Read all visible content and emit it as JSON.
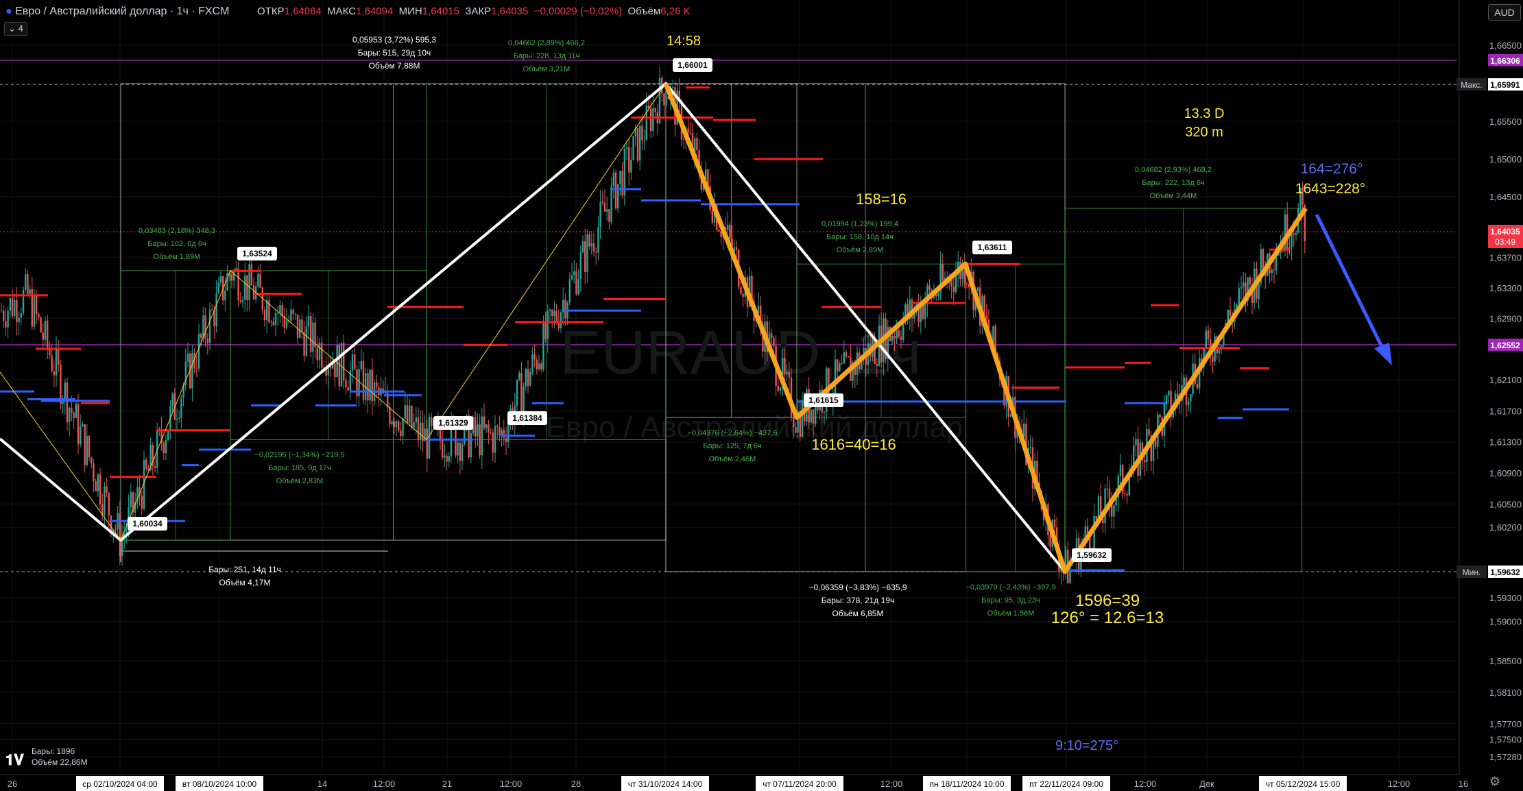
{
  "header": {
    "title": "Евро / Австралийский доллар · 1ч · FXCM",
    "open_label": "ОТКР",
    "open": "1,64064",
    "high_label": "МАКС",
    "high": "1,64094",
    "low_label": "МИН",
    "low": "1,64015",
    "close_label": "ЗАКР",
    "close": "1,64035",
    "change": "−0,00029 (−0,02%)",
    "volume_label": "Объём",
    "volume": "6,26 K",
    "indicator_count": "4",
    "currency": "AUD"
  },
  "watermark": {
    "symbol": "EURAUD, 1ч",
    "name": "Евро / Австралийский доллар"
  },
  "colors": {
    "up": "#26a69a",
    "down": "#ef5350",
    "red_level": "#ff1a1a",
    "blue_level": "#2962ff",
    "orange": "#f7a41d",
    "yellow_text": "#ffeb3b",
    "blue_text": "#5b6cf0",
    "purple_line": "#9c27b0",
    "green_text": "#4caf50"
  },
  "chart_data": {
    "type": "candlestick",
    "symbol": "EURAUD",
    "timeframe": "1ч",
    "ylim": [
      1.57,
      1.67
    ],
    "y_ticks": [
      "1,66500",
      "1,65500",
      "1,65000",
      "1,64500",
      "1,63700",
      "1,63300",
      "1,62900",
      "1,62100",
      "1,61700",
      "1,61300",
      "1,60900",
      "1,60500",
      "1,60200",
      "1,59300",
      "1,59000",
      "1,58500",
      "1,58100",
      "1,57700",
      "1,57500",
      "1,57280"
    ],
    "y_tick_values": [
      1.665,
      1.655,
      1.65,
      1.645,
      1.637,
      1.633,
      1.629,
      1.621,
      1.617,
      1.613,
      1.609,
      1.605,
      1.602,
      1.593,
      1.59,
      1.585,
      1.581,
      1.577,
      1.575,
      1.5728
    ],
    "price_tags": [
      {
        "text": "1,66306",
        "value": 1.66306,
        "color": "#9c27b0"
      },
      {
        "text": "Макс.",
        "value": 1.65991,
        "color": "#333",
        "secondary": "1,65991"
      },
      {
        "text": "1,64035",
        "value": 1.64035,
        "color": "#f23645",
        "secondary": "03:49"
      },
      {
        "text": "1,62552",
        "value": 1.62552,
        "color": "#9c27b0"
      },
      {
        "text": "Мин.",
        "value": 1.59632,
        "color": "#333",
        "secondary": "1,59632"
      }
    ],
    "x_labels": [
      {
        "text": "26",
        "x": 18,
        "hl": false
      },
      {
        "text": "ср 02/10/2024   04:00",
        "x": 175,
        "hl": true
      },
      {
        "text": "вт 08/10/2024   10:00",
        "x": 320,
        "hl": true
      },
      {
        "text": "14",
        "x": 470,
        "hl": false
      },
      {
        "text": "12:00",
        "x": 560,
        "hl": false
      },
      {
        "text": "21",
        "x": 652,
        "hl": false
      },
      {
        "text": "12:00",
        "x": 745,
        "hl": false
      },
      {
        "text": "28",
        "x": 840,
        "hl": false
      },
      {
        "text": "чт 31/10/2024   14:00",
        "x": 970,
        "hl": true
      },
      {
        "text": "чт 07/11/2024   20:00",
        "x": 1166,
        "hl": true
      },
      {
        "text": "12:00",
        "x": 1300,
        "hl": false
      },
      {
        "text": "пн 18/11/2024   10:00",
        "x": 1410,
        "hl": true
      },
      {
        "text": "пт 22/11/2024   09:00",
        "x": 1555,
        "hl": true
      },
      {
        "text": "12:00",
        "x": 1670,
        "hl": false
      },
      {
        "text": "Дек",
        "x": 1760,
        "hl": false
      },
      {
        "text": "чт 05/12/2024   15:00",
        "x": 1900,
        "hl": true
      },
      {
        "text": "12:00",
        "x": 2040,
        "hl": false
      },
      {
        "text": "16",
        "x": 2134,
        "hl": false
      }
    ],
    "pivots": [
      {
        "label": "1,60034",
        "value": 1.60034
      },
      {
        "label": "1,63524",
        "value": 1.63524
      },
      {
        "label": "1,61329",
        "value": 1.61329
      },
      {
        "label": "1,61384",
        "value": 1.61384
      },
      {
        "label": "1,66001",
        "value": 1.66001
      },
      {
        "label": "1,61615",
        "value": 1.61615
      },
      {
        "label": "1,63611",
        "value": 1.63611
      },
      {
        "label": "1,59632",
        "value": 1.59632
      }
    ],
    "range_boxes": [
      {
        "lines": [
          "0,05953 (3,72%) 595,3",
          "Бары: 515, 29д 10ч",
          "Объём 7,88M"
        ],
        "color": "#ffffff"
      },
      {
        "lines": [
          "0,04662 (2,89%) 466,2",
          "Бары: 228, 13д 11ч",
          "Объём 3,21M"
        ],
        "color": "#4caf50"
      },
      {
        "lines": [
          "0,03483 (2,18%) 348,3",
          "Бары: 102, 6д 6ч",
          "Объём 1,89M"
        ],
        "color": "#4caf50"
      },
      {
        "lines": [
          "−0,02195 (−1,34%) −219,5",
          "Бары: 185, 9д 17ч",
          "Объём 2,83M"
        ],
        "color": "#4caf50"
      },
      {
        "lines": [
          "Бары: 251, 14д 11ч",
          "Объём 4,17M"
        ],
        "color": "#ffffff"
      },
      {
        "lines": [
          "−0,04376 (−2,64%) −437,6",
          "Бары: 125, 7д 6ч",
          "Объём 2,46M"
        ],
        "color": "#4caf50"
      },
      {
        "lines": [
          "0,01994 (1,23%) 199,4",
          "Бары: 158, 10д 14ч",
          "Объём 2,89M"
        ],
        "color": "#4caf50"
      },
      {
        "lines": [
          "−0,06359 (−3,83%) −635,9",
          "Бары: 378, 21д 19ч",
          "Объём 6,85M"
        ],
        "color": "#ffffff"
      },
      {
        "lines": [
          "−0,03979 (−2,43%) −397,9",
          "Бары: 95, 3д 23ч",
          "Объём 1,56M"
        ],
        "color": "#4caf50"
      },
      {
        "lines": [
          "0,04682 (2,93%) 468,2",
          "Бары: 222, 13д 6ч",
          "Объём 3,44M"
        ],
        "color": "#4caf50"
      }
    ],
    "annotations": [
      {
        "text": "14:58",
        "color": "#ffeb3b"
      },
      {
        "text": "13.3 D",
        "color": "#ffeb3b"
      },
      {
        "text": "320 m",
        "color": "#ffeb3b"
      },
      {
        "text": "158=16",
        "color": "#ffeb3b"
      },
      {
        "text": "164=276°",
        "color": "#5b6cf0"
      },
      {
        "text": "1643=228°",
        "color": "#ffeb3b"
      },
      {
        "text": "1616=40=16",
        "color": "#ffeb3b"
      },
      {
        "text": "1596=39",
        "color": "#ffeb3b"
      },
      {
        "text": "126° = 12.6=13",
        "color": "#ffeb3b"
      },
      {
        "text": "9:10=275°",
        "color": "#5b6cf0"
      }
    ]
  },
  "footer": {
    "bars_label": "Бары: 1896",
    "volume_label": "Объём 22,86M"
  }
}
